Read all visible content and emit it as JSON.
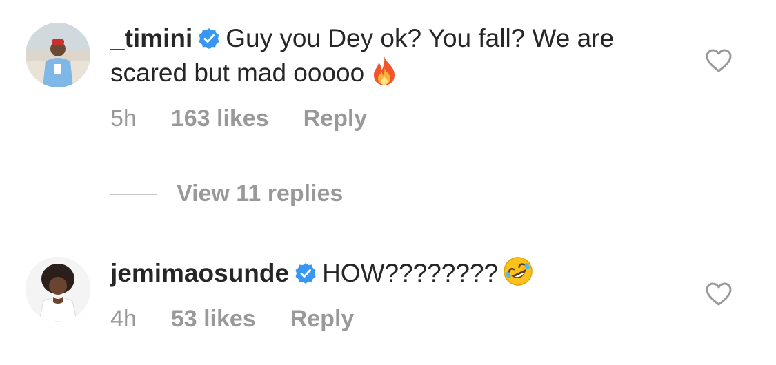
{
  "comments": [
    {
      "username": "_timini",
      "text": "Guy you Dey ok? You fall? We are scared but mad ooooo",
      "emoji": "fire-emoji",
      "time": "5h",
      "likes": "163 likes",
      "reply": "Reply",
      "verified": true
    },
    {
      "username": "jemimaosunde",
      "text": "HOW????????",
      "emoji": "rolling-on-floor-laughing-emoji",
      "time": "4h",
      "likes": "53 likes",
      "reply": "Reply",
      "verified": true
    }
  ],
  "view_replies": "View 11 replies",
  "colors": {
    "text": "#262626",
    "meta": "#999999",
    "verified": "#3897f0"
  }
}
